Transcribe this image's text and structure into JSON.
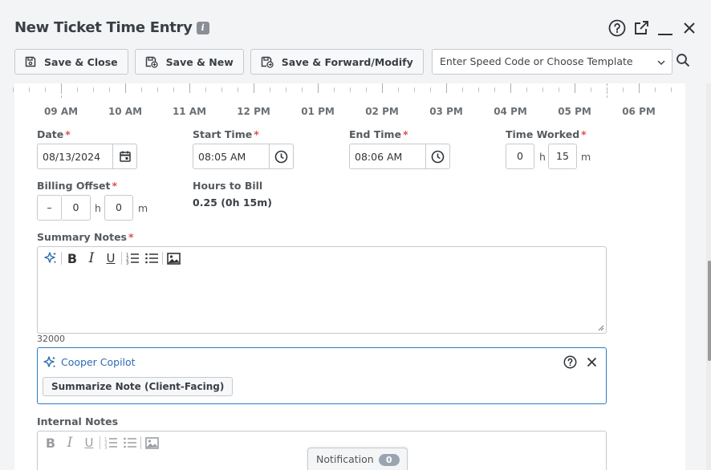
{
  "window": {
    "title": "New Ticket Time Entry",
    "info_icon": "info-icon",
    "icons": [
      "help-icon",
      "popout-icon",
      "minimize-icon",
      "close-icon"
    ]
  },
  "toolbar": {
    "save_close_label": "Save & Close",
    "save_new_label": "Save & New",
    "save_forward_label": "Save & Forward/Modify",
    "speed_code_placeholder": "Enter Speed Code or Choose Template"
  },
  "timeline": {
    "hours": [
      "09 AM",
      "10 AM",
      "11 AM",
      "12 PM",
      "01 PM",
      "02 PM",
      "03 PM",
      "04 PM",
      "05 PM",
      "06 PM"
    ]
  },
  "form": {
    "date": {
      "label": "Date",
      "required": "*",
      "value": "08/13/2024"
    },
    "start_time": {
      "label": "Start Time",
      "required": "*",
      "value": "08:05 AM"
    },
    "end_time": {
      "label": "End Time",
      "required": "*",
      "value": "08:06 AM"
    },
    "time_worked": {
      "label": "Time Worked",
      "required": "*",
      "hours": "0",
      "hours_unit": "h",
      "minutes": "15",
      "minutes_unit": "m"
    },
    "billing_offset": {
      "label": "Billing Offset",
      "required": "*",
      "sign": "–",
      "hours": "0",
      "hours_unit": "h",
      "minutes": "0",
      "minutes_unit": "m"
    },
    "hours_to_bill": {
      "label": "Hours to Bill",
      "value": "0.25 (0h 15m)"
    },
    "summary_notes": {
      "label": "Summary Notes",
      "required": "*",
      "char_counter": "32000"
    },
    "internal_notes": {
      "label": "Internal Notes"
    }
  },
  "copilot": {
    "title": "Cooper Copilot",
    "action_label": "Summarize Note (Client-Facing)"
  },
  "notification": {
    "label": "Notification",
    "count": "0"
  },
  "colors": {
    "required": "#d9534f",
    "copilot_accent": "#2b7bc4",
    "background": "#f3f4f6"
  }
}
